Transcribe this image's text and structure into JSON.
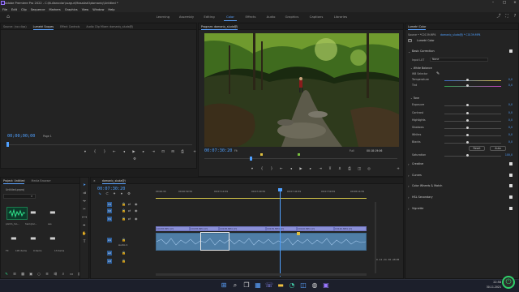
{
  "window": {
    "title": "Adobe Premiere Pro 2022 - C:\\Kullanıcılar\\ıuzgur\\Masaüstü\\domaniç\\Untitled *",
    "controls": [
      "–",
      "□",
      "×"
    ]
  },
  "menu": [
    "File",
    "Edit",
    "Clip",
    "Sequence",
    "Markers",
    "Graphics",
    "View",
    "Window",
    "Help"
  ],
  "workspaces": {
    "tabs": [
      "Learning",
      "Assembly",
      "Editing",
      "Color",
      "Effects",
      "Audio",
      "Graphics",
      "Captions",
      "Libraries"
    ],
    "active": "Color"
  },
  "source_panel": {
    "tabs": [
      "Source: (no clips)",
      "Lumetri Scopes",
      "Effect Controls",
      "Audio Clip Mixer: domaniç_sluda@j"
    ],
    "active_tab": "Lumetri Scopes",
    "timecode": "00;00;00;00",
    "page": "Page 1"
  },
  "program_panel": {
    "tab": "Program: domaniç_sluda@j",
    "timecode": "00:07:30:20",
    "fit": "Fit",
    "quality": "Full",
    "duration": "00:18:19:06"
  },
  "lumetri": {
    "tab": "Lumetri Color",
    "source_line": "Source • *C0139.MP4",
    "target_line": "domaniç_sluda@j * C0139.MP4",
    "fx_label": "Lumetri Color",
    "basic_correction": "Basic Correction",
    "input_lut_label": "Input LUT",
    "input_lut_value": "None",
    "white_balance": "White Balance",
    "wb_selector": "WB Selector",
    "temperature": "Temperature",
    "temperature_value": "0,0",
    "tint": "Tint",
    "tint_value": "0,0",
    "tone": "Tone",
    "tone_rows": [
      {
        "label": "Exposure",
        "value": "0,0"
      },
      {
        "label": "Contrast",
        "value": "0,0"
      },
      {
        "label": "Highlights",
        "value": "0,0"
      },
      {
        "label": "Shadows",
        "value": "0,0"
      },
      {
        "label": "Whites",
        "value": "0,0"
      },
      {
        "label": "Blacks",
        "value": "0,0"
      }
    ],
    "reset_label": "Reset",
    "auto_label": "Auto",
    "saturation": "Saturation",
    "saturation_value": "100,0",
    "sections": [
      "Creative",
      "Curves",
      "Color Wheels & Match",
      "HSL Secondary",
      "Vignette"
    ]
  },
  "project_panel": {
    "tabs": [
      "Project: Untitled",
      "Media Browser"
    ],
    "active_tab": "Project: Untitled",
    "file": "Untitled.prproj",
    "items": [
      {
        "name": "pixlim_mo...",
        "meta": "hanlıçlar..."
      },
      {
        "name": "ses",
        "meta": ""
      },
      {
        "name": "ses",
        "meta": ""
      },
      {
        "name": "FX",
        "meta": "105 items"
      },
      {
        "name": "",
        "meta": "0 items"
      },
      {
        "name": "",
        "meta": "13 items"
      }
    ]
  },
  "timeline": {
    "tab": "domaniç_sluda@j",
    "timecode": "00:07:30:20",
    "ruler": [
      "00:06:30",
      "00:06:59:59",
      "00:07:14:59",
      "00:07:29:59",
      "00:07:44:59",
      "00:07:59:59",
      "00:08:14:59"
    ],
    "tracks": [
      {
        "name": "V3",
        "type": "video"
      },
      {
        "name": "V2",
        "type": "video"
      },
      {
        "name": "V1",
        "type": "video"
      },
      {
        "name": "A1",
        "label": "Audio 1",
        "type": "audio"
      },
      {
        "name": "A2",
        "type": "audio"
      },
      {
        "name": "A3",
        "type": "audio"
      }
    ],
    "video_clips": [
      "C0138.MP4 [V]",
      "C0138.MP4 [V]",
      "C0138.MP4 [V]",
      "C0139.MP4 [V]",
      "C0140.MP4 [V]",
      "C0140.MP4 [V]"
    ]
  },
  "colors": {
    "accent": "#4fa0ff",
    "video_clip": "#8a8fd6",
    "audio_clip": "#4f7ea6",
    "panel_bg": "#232323",
    "app_bg": "#1d1d1d",
    "taskbar": "#1c1f2b"
  },
  "taskbar": {
    "icons": [
      "windows-start-icon",
      "search-icon",
      "task-view-icon",
      "widgets-icon",
      "chat-icon",
      "file-explorer-icon",
      "edge-icon",
      "store-icon",
      "steam-icon",
      "premiere-icon"
    ],
    "time": "22:58",
    "date": "30.11.2021"
  }
}
